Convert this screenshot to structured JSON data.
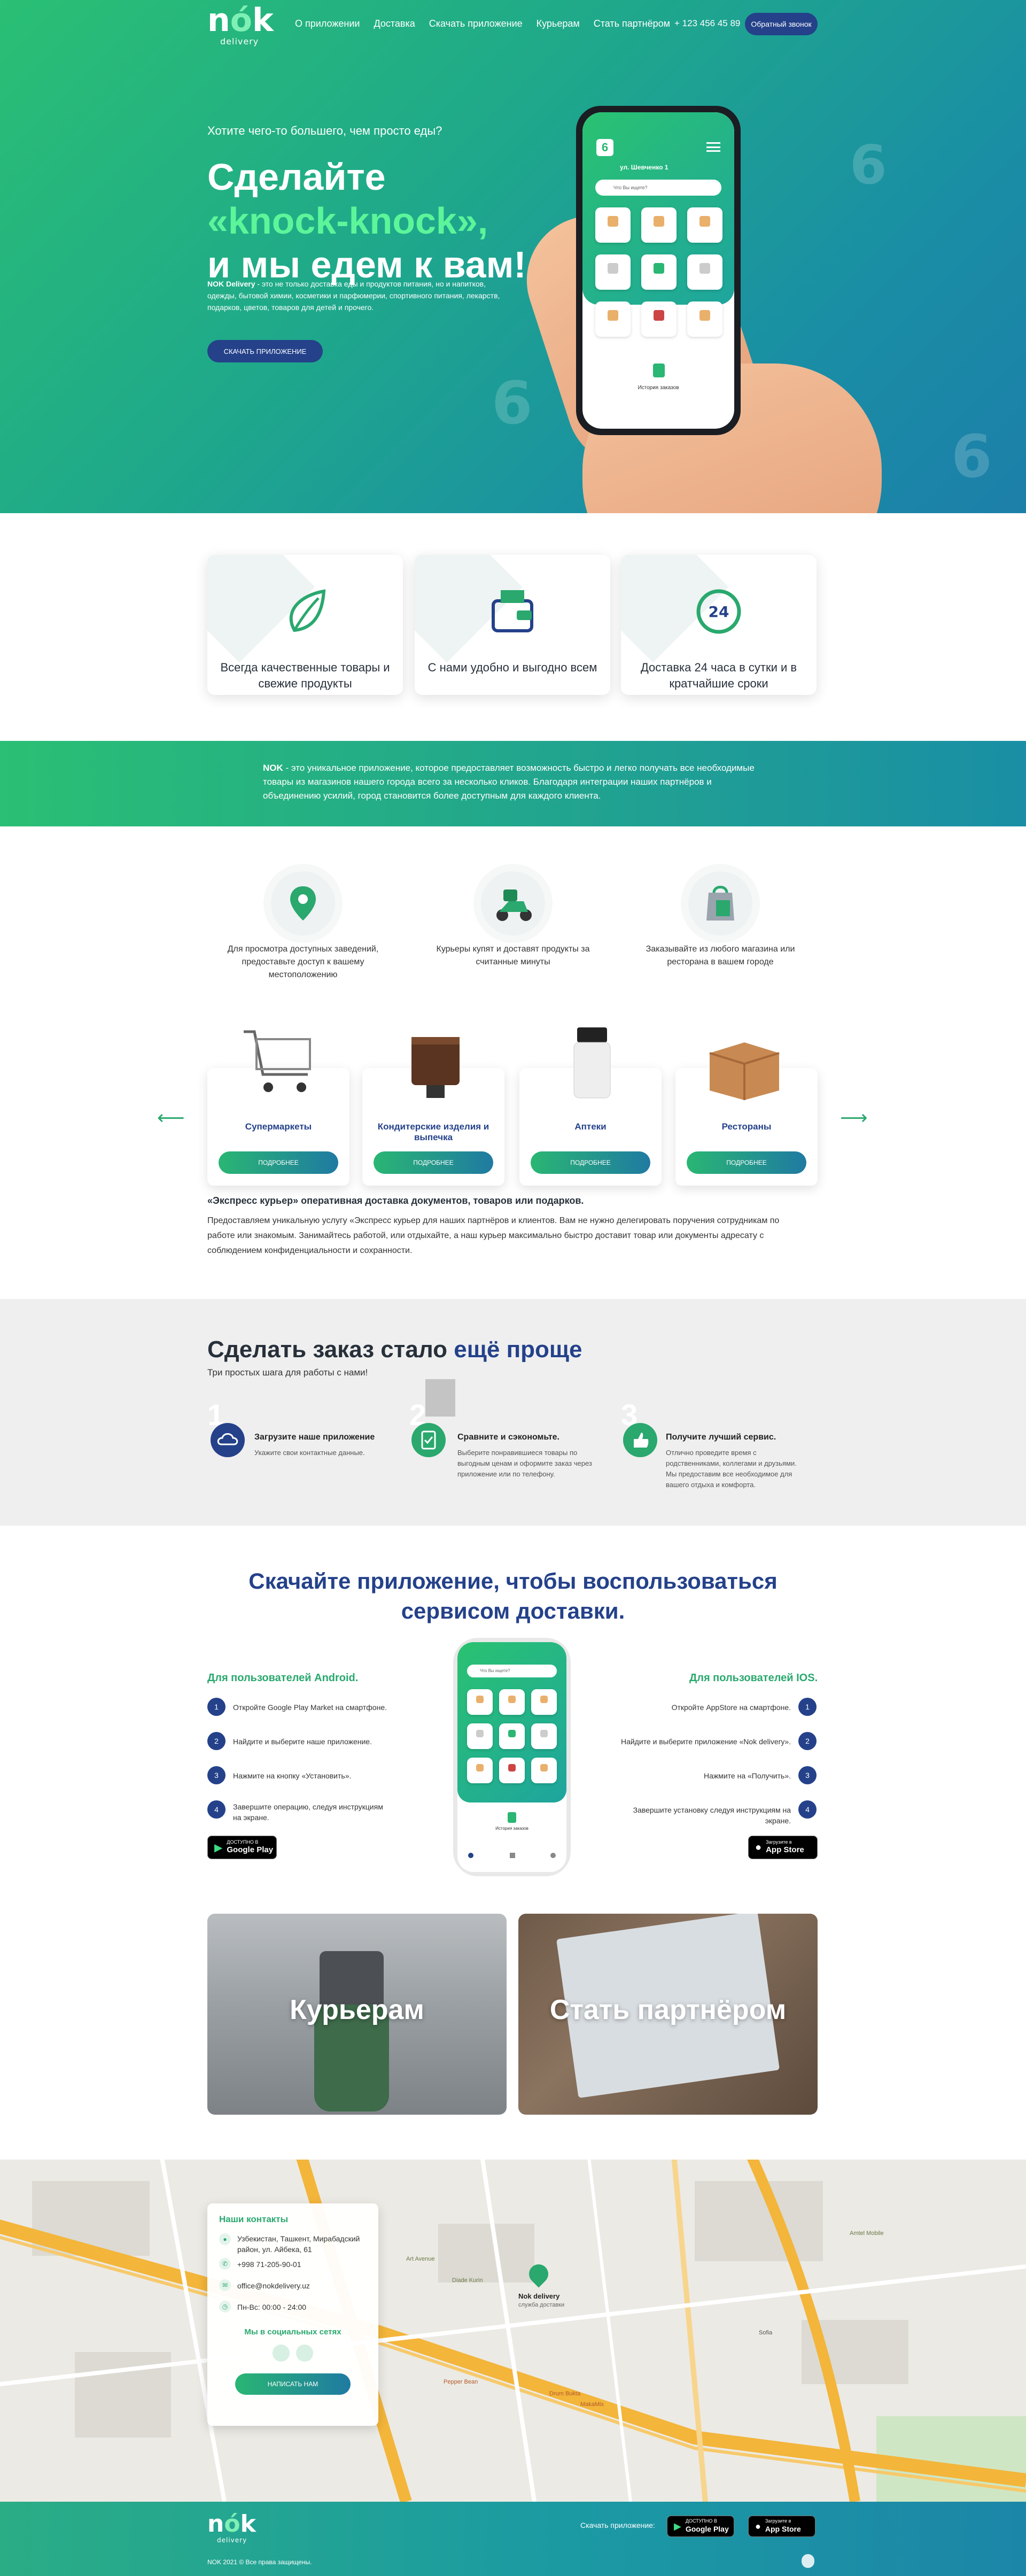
{
  "header": {
    "logo_text": "nók",
    "logo_sub": "delivery",
    "nav": [
      "О приложении",
      "Доставка",
      "Скачать приложение",
      "Курьерам",
      "Стать партнёром"
    ],
    "phone": "+ 123 456 45 89",
    "callback_button": "Обратный звонок"
  },
  "hero": {
    "pre_title": "Хотите чего-то большего, чем просто еды?",
    "title_line1": "Сделайте",
    "title_highlight": "«knock-knock»,",
    "title_line3": "и мы едем к вам!",
    "desc_bold": "NOK Delivery",
    "desc": " - это не только доставка еды и продуктов питания, но и напитков, одежды, бытовой химии, косметики и парфюмерии, спортивного питания, лекарств, подарков, цветов, товаров для детей и прочего.",
    "download_button": "СКАЧАТЬ ПРИЛОЖЕНИЕ",
    "phone_screen": {
      "address": "ул. Шевченко 1",
      "search_placeholder": "Что Вы ищете?",
      "history": "История заказов"
    }
  },
  "features": [
    {
      "text": "Всегда качественные товары и свежие продукты",
      "icon": "leaf-icon"
    },
    {
      "text": "С нами удобно и выгодно всем",
      "icon": "wallet-icon"
    },
    {
      "text": "Доставка 24 часа в сутки и в кратчайшие сроки",
      "icon": "clock-24-icon"
    }
  ],
  "about": {
    "brand": "NOK",
    "text": " - это уникальное приложение, которое предоставляет возможность быстро и легко получать все необходимые товары из магазинов нашего города всего за несколько кликов. Благодаря интеграции наших партнёров и объединению усилий, город становится более доступным для каждого клиента."
  },
  "how": [
    {
      "icon": "location-pin-icon",
      "text": "Для просмотра доступных заведений, предоставьте доступ к вашему местоположению"
    },
    {
      "icon": "scooter-courier-icon",
      "text": "Курьеры купят и доставят продукты за считанные минуты"
    },
    {
      "icon": "shopping-bag-icon",
      "text": "Заказывайте из любого магазина или ресторана в вашем городе"
    }
  ],
  "categories": [
    {
      "title": "Супермаркеты",
      "button": "ПОДРОБНЕЕ",
      "image": "cart-icon"
    },
    {
      "title": "Кондитерские изделия и выпечка",
      "button": "ПОДРОБНЕЕ",
      "image": "cake-icon"
    },
    {
      "title": "Аптеки",
      "button": "ПОДРОБНЕЕ",
      "image": "pill-bottle-icon"
    },
    {
      "title": "Рестораны",
      "button": "ПОДРОБНЕЕ",
      "image": "box-icon"
    }
  ],
  "express": {
    "title": "«Экспресс курьер» оперативная доставка документов, товаров или подарков.",
    "text": "Предоставляем уникальную услугу «Экспресс курьер для наших партнёров и клиентов. Вам не нужно делегировать поручения сотрудникам по работе или знакомым. Занимайтесь работой, или отдыхайте, а наш курьер максимально быстро доставит товар или документы адресату с соблюдением конфиденциальности и сохранности."
  },
  "steps": {
    "title": "Сделать заказ стало",
    "title_highlight": "ещё проще",
    "subtitle": "Три простых шага для работы с нами!",
    "items": [
      {
        "num": "1",
        "title": "Загрузите наше приложение",
        "text": "Укажите свои контактные данные."
      },
      {
        "num": "2",
        "title": "Сравните и сэкономьте.",
        "text": "Выберите понравившиеся товары по выгодным ценам и оформите заказ через приложение или по телефону."
      },
      {
        "num": "3",
        "title": "Получите лучший сервис.",
        "text": "Отлично проведите время с родственниками, коллегами и друзьями. Мы предоставим все необходимое для вашего отдыха и комфорта."
      }
    ]
  },
  "app": {
    "title_highlight": "Скачайте приложение,",
    "title_rest": " чтобы воспользоваться",
    "title_line2": "сервисом доставки.",
    "android_title": "Для пользователей Android.",
    "android_steps": [
      "Откройте Google Play Market на смартфоне.",
      "Найдите и выберите наше приложение.",
      "Нажмите на кнопку «Установить».",
      "Завершите операцию, следуя инструкциям на экране."
    ],
    "ios_title": "Для пользователей IOS.",
    "ios_steps": [
      "Откройте AppStore на смартфоне.",
      "Найдите и выберите приложение «Nok delivery».",
      "Нажмите на «Получить».",
      "Завершите установку следуя инструкциям на экране."
    ],
    "google_small": "ДОСТУПНО В",
    "google_big": "Google Play",
    "apple_small": "Загрузите в",
    "apple_big": "App Store",
    "screen_search": "Что Вы ищете?",
    "screen_history": "История заказов"
  },
  "promo": {
    "couriers": "Курьерам",
    "partner": "Стать партнёром"
  },
  "contacts": {
    "title": "Наши контакты",
    "address": "Узбекистан, Ташкент, Мирабадский район, ул. Айбека, 61",
    "phone": "+998 71-205-90-01",
    "email": "office@nokdelivery.uz",
    "hours": "Пн-Вс: 00:00 - 24:00",
    "social_title": "Мы в социальных сетях",
    "write_button": "НАПИСАТЬ НАМ"
  },
  "map": {
    "marker_title": "Nok delivery",
    "marker_sub": "служба доставки",
    "labels": [
      "Art Avenue",
      "Sofia",
      "Amtel Mobile",
      "Drum Bukta",
      "Pepper Bean",
      "MakaMix",
      "Diade Kurin"
    ]
  },
  "footer": {
    "download_label": "Скачать приложение:",
    "copyright": "NOK 2021 © Все права защищены.",
    "google_small": "ДОСТУПНО В",
    "google_big": "Google Play",
    "apple_small": "Загрузите в",
    "apple_big": "App Store"
  },
  "colors": {
    "green": "#2abf74",
    "teal": "#1a8ea5",
    "navy": "#24418a",
    "accent_light_green": "#5cf59a"
  }
}
